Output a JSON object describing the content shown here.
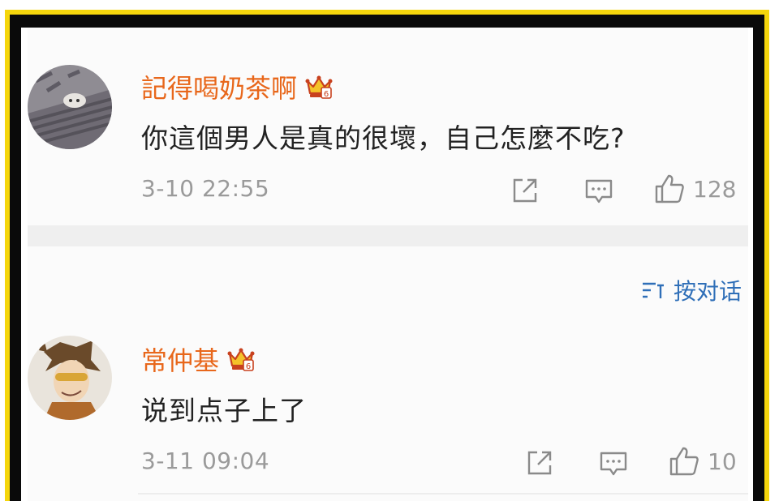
{
  "comments": [
    {
      "username": "記得喝奶茶啊",
      "text": "你這個男人是真的很壞，自己怎麼不吃?",
      "time": "3-10 22:55",
      "likes": "128",
      "badge_icon": "crown-vip-icon"
    },
    {
      "username": "常仲基",
      "text": "说到点子上了",
      "time": "3-11 09:04",
      "likes": "10",
      "badge_icon": "crown-vip-icon"
    }
  ],
  "sort": {
    "label": "按对话",
    "icon": "sort-icon"
  },
  "colors": {
    "username": "#e8671b",
    "link": "#2f6fb8",
    "frame_yellow": "#f5d60c",
    "frame_black": "#0a0a0a"
  }
}
